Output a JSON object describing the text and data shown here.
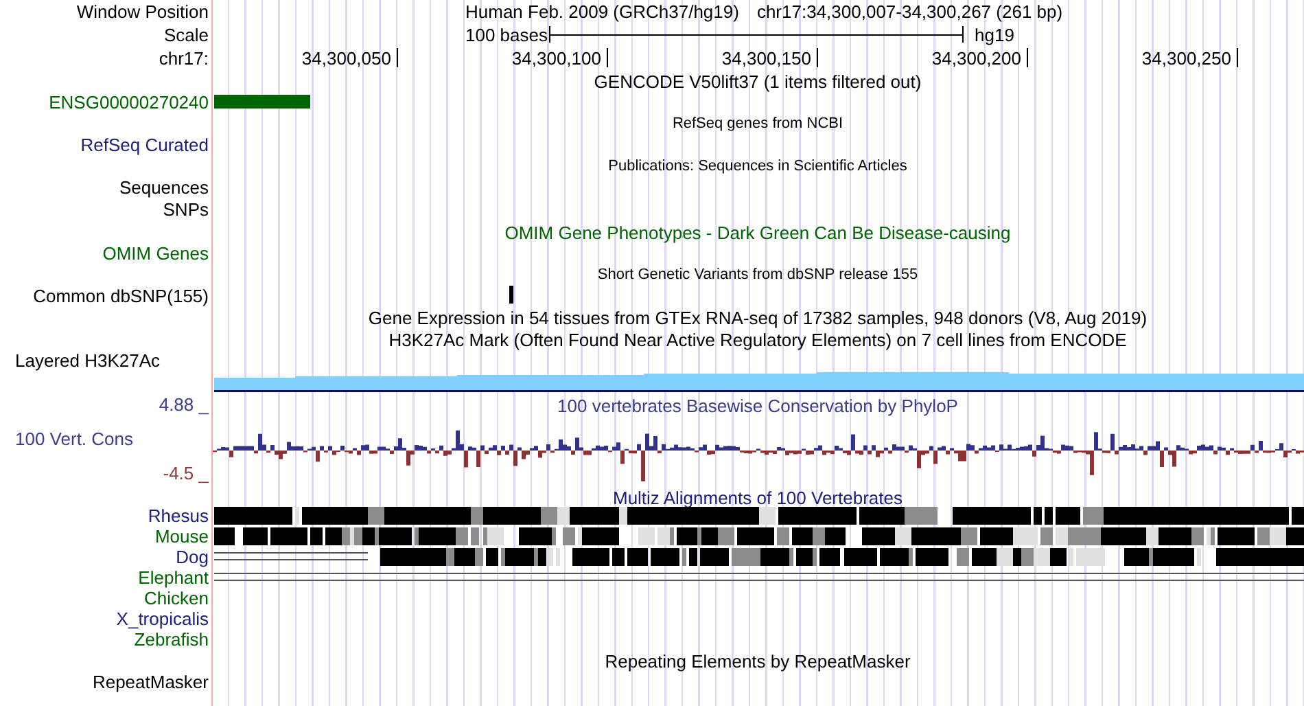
{
  "window_position": {
    "label": "Window Position",
    "assembly": "Human Feb. 2009 (GRCh37/hg19)",
    "position": "chr17:34,300,007-34,300,267 (261 bp)"
  },
  "scale": {
    "label": "Scale",
    "length": "100 bases",
    "assembly": "hg19"
  },
  "ruler": {
    "label": "chr17:",
    "ticks": [
      "34,300,050",
      "34,300,100",
      "34,300,150",
      "34,300,200",
      "34,300,250"
    ]
  },
  "tracks": [
    {
      "kind": "gene",
      "title": {
        "text": "GENCODE V50lift37 (1 items filtered out)",
        "color": "#000000",
        "small": false
      },
      "rows": [
        {
          "label": "ENSG00000270240",
          "color": "#006400"
        }
      ]
    },
    {
      "kind": "empty",
      "title": {
        "text": "RefSeq genes from NCBI",
        "color": "#000000",
        "small": true
      },
      "rows": [
        {
          "label": "RefSeq Curated",
          "color": "#20207a"
        }
      ]
    },
    {
      "kind": "empty",
      "title": {
        "text": "Publications: Sequences in Scientific Articles",
        "color": "#000000",
        "small": true
      },
      "rows": [
        {
          "label": "Sequences",
          "color": "#000000"
        }
      ]
    },
    {
      "kind": "empty",
      "rows": [
        {
          "label": "SNPs",
          "color": "#000000"
        }
      ]
    },
    {
      "kind": "empty",
      "title": {
        "text": "OMIM Gene Phenotypes - Dark Green Can Be Disease-causing",
        "color": "#006400",
        "small": false
      },
      "rows": [
        {
          "label": "OMIM Genes",
          "color": "#006400"
        }
      ]
    },
    {
      "kind": "snp",
      "title": {
        "text": "Short Genetic Variants from dbSNP release 155",
        "color": "#000000",
        "small": true
      },
      "rows": [
        {
          "label": "Common dbSNP(155)",
          "color": "#000000"
        }
      ]
    },
    {
      "kind": "empty",
      "title": {
        "text": "Gene Expression in 54 tissues from GTEx RNA-seq of 17382 samples, 948 donors (V8, Aug 2019)",
        "color": "#000000",
        "small": false
      }
    },
    {
      "kind": "signal",
      "title": {
        "text": "H3K27Ac Mark (Often Found Near Active Regulatory Elements) on 7 cell lines from ENCODE",
        "color": "#000000",
        "small": false
      },
      "rows": [
        {
          "label": "Layered H3K27Ac",
          "color": "#000000"
        }
      ]
    },
    {
      "kind": "wiggle",
      "title": {
        "text": "100 vertebrates Basewise Conservation by PhyloP",
        "color": "#3c3c8c",
        "small": false
      },
      "rows": [
        {
          "label": "4.88 _",
          "color": "#3c3c8c"
        },
        {
          "label": "100 Vert. Cons",
          "color": "#3c3c8c"
        },
        {
          "label": "-4.5 _",
          "color": "#8c3c3c"
        }
      ]
    },
    {
      "kind": "alignment",
      "title": {
        "text": "Multiz Alignments of 100 Vertebrates",
        "color": "#20207a",
        "small": false
      },
      "rows": [
        {
          "label": "Rhesus",
          "color": "#20207a",
          "kind": "blocks"
        },
        {
          "label": "Mouse",
          "color": "#006400",
          "kind": "mixed"
        },
        {
          "label": "Dog",
          "color": "#20207a",
          "kind": "partial"
        },
        {
          "label": "Elephant",
          "color": "#006400",
          "kind": "lines"
        },
        {
          "label": "Chicken",
          "color": "#006400",
          "kind": "none"
        },
        {
          "label": "X_tropicalis",
          "color": "#20207a",
          "kind": "none"
        },
        {
          "label": "Zebrafish",
          "color": "#006400",
          "kind": "none"
        }
      ]
    },
    {
      "kind": "empty",
      "title": {
        "text": "Repeating Elements by RepeatMasker",
        "color": "#000000",
        "small": false
      },
      "rows": [
        {
          "label": "RepeatMasker",
          "color": "#000000"
        }
      ]
    }
  ]
}
